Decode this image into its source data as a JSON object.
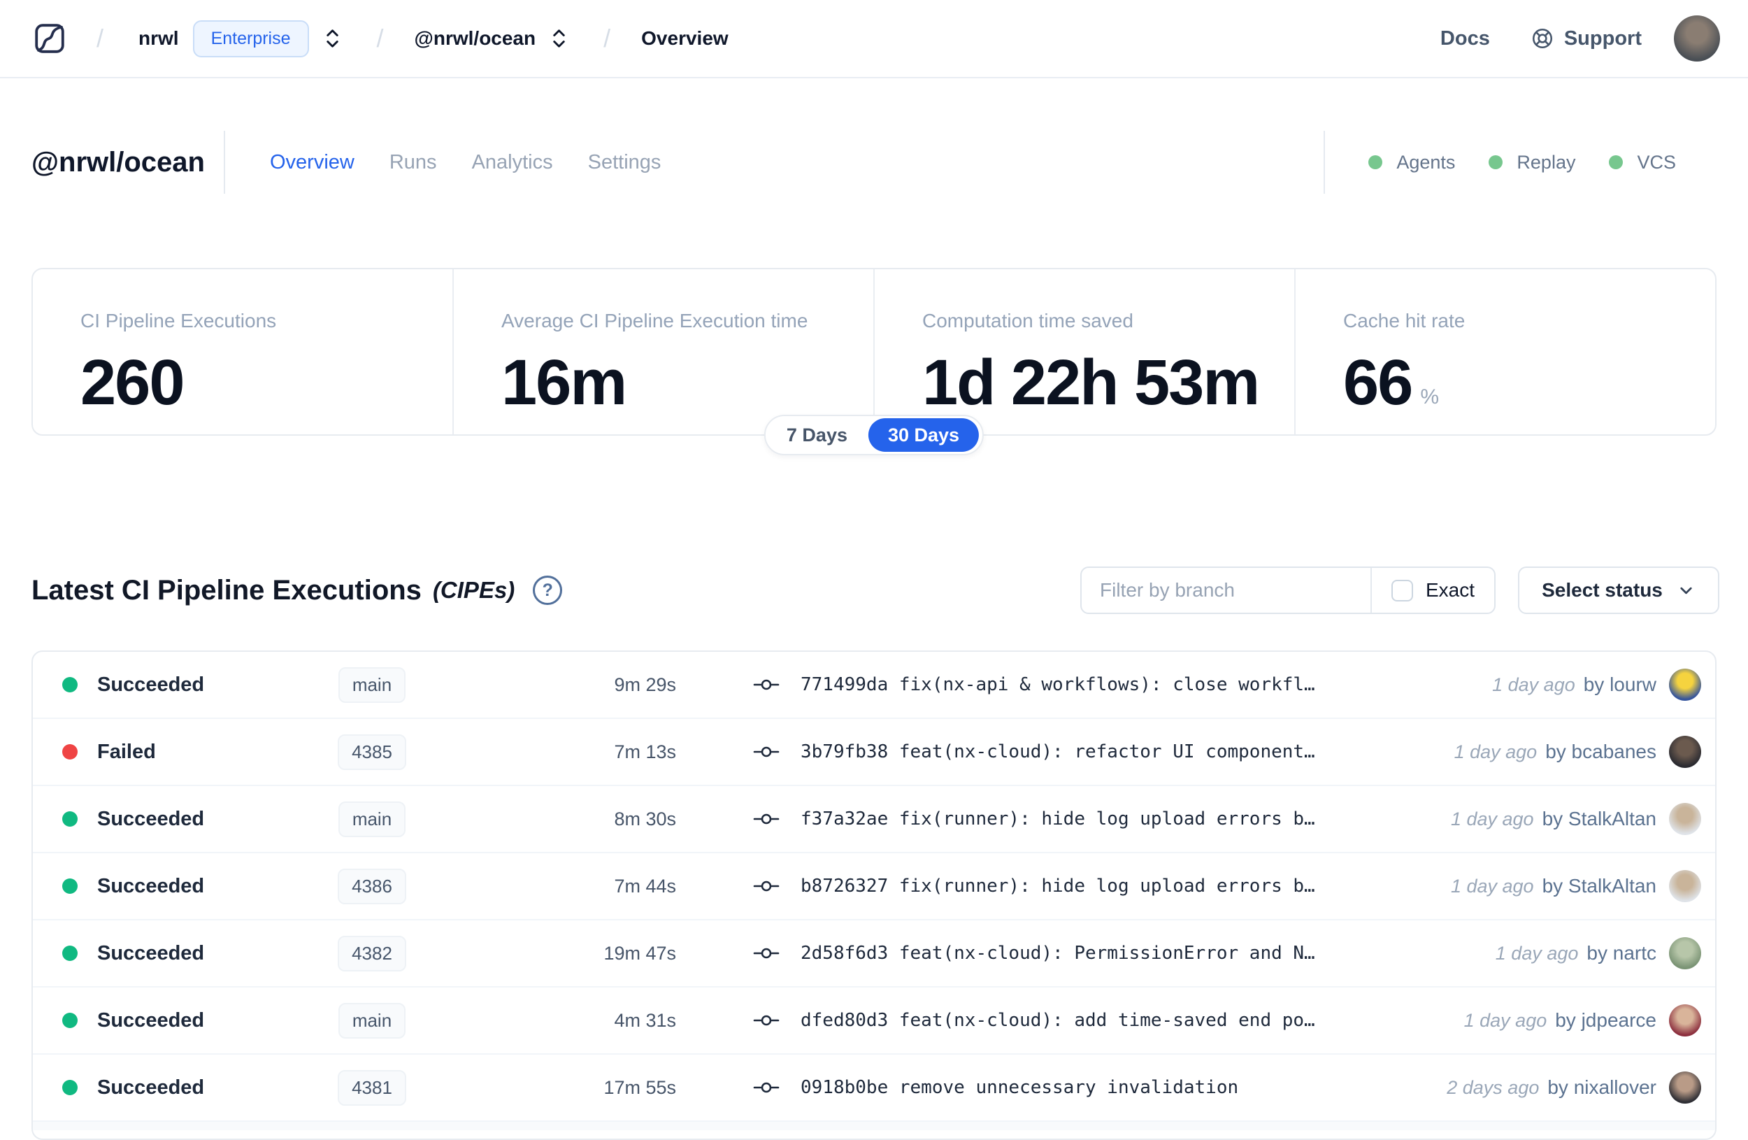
{
  "topbar": {
    "org": "nrwl",
    "org_badge": "Enterprise",
    "workspace": "@nrwl/ocean",
    "page": "Overview",
    "docs_label": "Docs",
    "support_label": "Support",
    "avatar_colors": [
      "#8a7d72",
      "#4a4f55"
    ]
  },
  "header": {
    "workspace_title": "@nrwl/ocean",
    "tabs": [
      {
        "label": "Overview",
        "active": true
      },
      {
        "label": "Runs",
        "active": false
      },
      {
        "label": "Analytics",
        "active": false
      },
      {
        "label": "Settings",
        "active": false
      }
    ],
    "indicators": [
      {
        "label": "Agents",
        "color": "#77c78e"
      },
      {
        "label": "Replay",
        "color": "#77c78e"
      },
      {
        "label": "VCS",
        "color": "#77c78e"
      }
    ]
  },
  "stats": {
    "cards": [
      {
        "label": "CI Pipeline Executions",
        "value": "260",
        "suffix": ""
      },
      {
        "label": "Average CI Pipeline Execution time",
        "value": "16m",
        "suffix": ""
      },
      {
        "label": "Computation time saved",
        "value": "1d 22h 53m",
        "suffix": ""
      },
      {
        "label": "Cache hit rate",
        "value": "66",
        "suffix": "%"
      }
    ],
    "range_toggle": {
      "options": [
        "7 Days",
        "30 Days"
      ],
      "selected": "30 Days",
      "selected_color": "#2563eb"
    }
  },
  "cipes": {
    "title": "Latest CI Pipeline Executions",
    "title_suffix": "(CIPEs)",
    "help_glyph": "?",
    "filter_placeholder": "Filter by branch",
    "exact_label": "Exact",
    "status_button_label": "Select status",
    "rows": [
      {
        "status": "Succeeded",
        "status_color": "#10b981",
        "branch": "main",
        "duration": "9m 29s",
        "commit": "771499da fix(nx-api & workflows): close workfl…",
        "time_ago": "1 day ago",
        "author": "by lourw",
        "avatar": [
          "#f5d33f",
          "#35549c"
        ]
      },
      {
        "status": "Failed",
        "status_color": "#ef4444",
        "branch": "4385",
        "duration": "7m 13s",
        "commit": "3b79fb38 feat(nx-cloud): refactor UI component…",
        "time_ago": "1 day ago",
        "author": "by bcabanes",
        "avatar": [
          "#6b5a4e",
          "#2a2a30"
        ]
      },
      {
        "status": "Succeeded",
        "status_color": "#10b981",
        "branch": "main",
        "duration": "8m 30s",
        "commit": "f37a32ae fix(runner): hide log upload errors b…",
        "time_ago": "1 day ago",
        "author": "by StalkAltan",
        "avatar": [
          "#c9b49a",
          "#dfe3e8"
        ]
      },
      {
        "status": "Succeeded",
        "status_color": "#10b981",
        "branch": "4386",
        "duration": "7m 44s",
        "commit": "b8726327 fix(runner): hide log upload errors b…",
        "time_ago": "1 day ago",
        "author": "by StalkAltan",
        "avatar": [
          "#c9b49a",
          "#dfe3e8"
        ]
      },
      {
        "status": "Succeeded",
        "status_color": "#10b981",
        "branch": "4382",
        "duration": "19m 47s",
        "commit": "2d58f6d3 feat(nx-cloud): PermissionError and N…",
        "time_ago": "1 day ago",
        "author": "by nartc",
        "avatar": [
          "#b7c6a9",
          "#7a9374"
        ]
      },
      {
        "status": "Succeeded",
        "status_color": "#10b981",
        "branch": "main",
        "duration": "4m 31s",
        "commit": "dfed80d3 feat(nx-cloud): add time-saved end po…",
        "time_ago": "1 day ago",
        "author": "by jdpearce",
        "avatar": [
          "#d9b49a",
          "#8c2f3e"
        ]
      },
      {
        "status": "Succeeded",
        "status_color": "#10b981",
        "branch": "4381",
        "duration": "17m 55s",
        "commit": "0918b0be remove unnecessary invalidation",
        "time_ago": "2 days ago",
        "author": "by nixallover",
        "avatar": [
          "#b99b87",
          "#2e2e34"
        ]
      }
    ]
  }
}
